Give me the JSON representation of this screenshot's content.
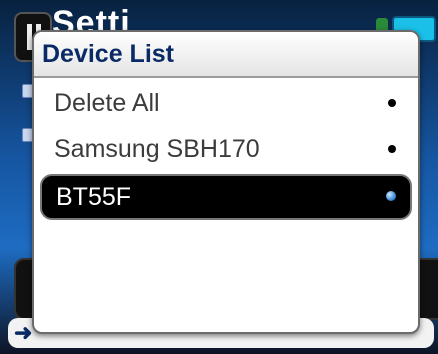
{
  "background": {
    "title": "Setti",
    "icons": [
      "pause-icon",
      "bluetooth-icon",
      "battery-icon",
      "expand-icon",
      "collapse-icon",
      "arrow-right-icon"
    ]
  },
  "popup": {
    "title": "Device List",
    "items": [
      {
        "label": "Delete All",
        "selected": false
      },
      {
        "label": "Samsung SBH170",
        "selected": false
      },
      {
        "label": "BT55F",
        "selected": true
      }
    ]
  },
  "colors": {
    "title_text": "#0a2a66",
    "selected_bg": "#000000",
    "selected_text": "#ffffff",
    "selected_dot": "#3b8bd9"
  }
}
